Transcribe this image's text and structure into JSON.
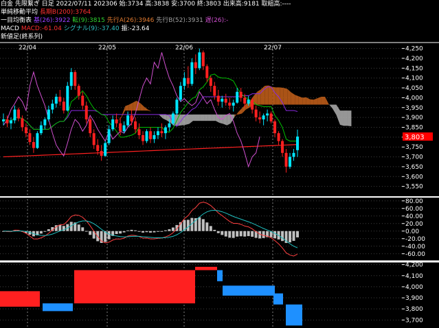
{
  "header": {
    "line1": "白金 先限繋ぎ 日足 2022/07/11 202306 始:3734 高:3838 安:3700 終:3803 出来高:9181 取組高:----",
    "line2_label": "単純移動平均",
    "line2_value": "長期B(200):3764",
    "line3_label": "一目均衡表",
    "line3_base": "基(26):3922",
    "line3_conv": "転(9):3815",
    "line3_spanA": "先行A(26):3946",
    "line3_spanB": "先行B(52):3931",
    "line3_lag": "遅(26):-",
    "line4_label": "MACD",
    "line4_macd": "MACD:-61.04",
    "line4_signal": "シグナル(9):-37.40",
    "line4_hist": "振:-23.64",
    "line5_label": "新値足(終系列)"
  },
  "colors": {
    "up": "#00e5ff",
    "down": "#ff2020",
    "ma200": "#ff2020",
    "base": "#8a2be2",
    "conversion": "#00c000",
    "lagging": "#d050d0",
    "cloud_bull": "#c8621a",
    "cloud_bear": "#b0b0b0",
    "macd": "#ff4040",
    "signal": "#20c0c0",
    "histogram": "#c0c0c0",
    "grid": "#404040",
    "price_tag": "#ff0000"
  },
  "chart_data": [
    {
      "type": "candlestick",
      "panel": "price",
      "x_labels": [
        "22/04",
        "22/05",
        "22/06",
        "22/07"
      ],
      "ylim": [
        3500,
        4280
      ],
      "y_ticks": [
        3550,
        3600,
        3650,
        3700,
        3750,
        3800,
        3850,
        3900,
        3950,
        4000,
        4050,
        4100,
        4150,
        4200,
        4250
      ],
      "y_tick_labels": [
        "3,550",
        "3,600",
        "3,650",
        "3,700",
        "3,750",
        "3,800",
        "3,850",
        "3,900",
        "3,950",
        "4,000",
        "4,050",
        "4,100",
        "4,150",
        "4,200",
        "4,250"
      ],
      "last_price_label": "3,803",
      "last_price": 3803,
      "candles": [
        [
          3880,
          3920,
          3860,
          3890
        ],
        [
          3890,
          3910,
          3850,
          3870
        ],
        [
          3870,
          3900,
          3840,
          3885
        ],
        [
          3885,
          3960,
          3870,
          3940
        ],
        [
          3940,
          3950,
          3880,
          3895
        ],
        [
          3895,
          3910,
          3830,
          3850
        ],
        [
          3850,
          3870,
          3800,
          3820
        ],
        [
          3820,
          3840,
          3760,
          3775
        ],
        [
          3775,
          3800,
          3720,
          3745
        ],
        [
          3745,
          3830,
          3740,
          3820
        ],
        [
          3820,
          3880,
          3810,
          3860
        ],
        [
          3860,
          3900,
          3840,
          3890
        ],
        [
          3890,
          3960,
          3880,
          3940
        ],
        [
          3940,
          3990,
          3920,
          3970
        ],
        [
          3970,
          4020,
          3950,
          4005
        ],
        [
          4005,
          4040,
          3960,
          3980
        ],
        [
          3980,
          4000,
          3920,
          3935
        ],
        [
          3935,
          4080,
          3930,
          4060
        ],
        [
          4060,
          4150,
          4040,
          4130
        ],
        [
          4130,
          4140,
          4040,
          4060
        ],
        [
          4060,
          4070,
          3990,
          4010
        ],
        [
          4010,
          4030,
          3940,
          3960
        ],
        [
          3960,
          3980,
          3870,
          3890
        ],
        [
          3890,
          3900,
          3800,
          3820
        ],
        [
          3820,
          3840,
          3740,
          3760
        ],
        [
          3760,
          3790,
          3710,
          3730
        ],
        [
          3730,
          3760,
          3680,
          3705
        ],
        [
          3705,
          3780,
          3700,
          3770
        ],
        [
          3770,
          3860,
          3760,
          3840
        ],
        [
          3840,
          3910,
          3830,
          3890
        ],
        [
          3890,
          3920,
          3850,
          3870
        ],
        [
          3870,
          3900,
          3810,
          3830
        ],
        [
          3830,
          3880,
          3820,
          3860
        ],
        [
          3860,
          3930,
          3850,
          3910
        ],
        [
          3910,
          3940,
          3860,
          3880
        ],
        [
          3880,
          3900,
          3820,
          3840
        ],
        [
          3840,
          3870,
          3790,
          3810
        ],
        [
          3810,
          3830,
          3760,
          3780
        ],
        [
          3780,
          3840,
          3770,
          3830
        ],
        [
          3830,
          3850,
          3770,
          3790
        ],
        [
          3790,
          3830,
          3770,
          3810
        ],
        [
          3810,
          3850,
          3790,
          3830
        ],
        [
          3830,
          3870,
          3800,
          3820
        ],
        [
          3820,
          3860,
          3790,
          3850
        ],
        [
          3850,
          3890,
          3830,
          3870
        ],
        [
          3870,
          3930,
          3860,
          3920
        ],
        [
          3920,
          4000,
          3910,
          3990
        ],
        [
          3990,
          4080,
          3980,
          4060
        ],
        [
          4060,
          4130,
          4040,
          4100
        ],
        [
          4100,
          4160,
          4050,
          4070
        ],
        [
          4070,
          4200,
          4060,
          4180
        ],
        [
          4180,
          4220,
          4120,
          4150
        ],
        [
          4150,
          4250,
          4140,
          4230
        ],
        [
          4230,
          4240,
          4140,
          4160
        ],
        [
          4160,
          4170,
          4080,
          4100
        ],
        [
          4100,
          4110,
          4030,
          4060
        ],
        [
          4060,
          4080,
          3990,
          4010
        ],
        [
          4010,
          4040,
          3960,
          3980
        ],
        [
          3980,
          4010,
          3950,
          3995
        ],
        [
          3995,
          4020,
          3960,
          3975
        ],
        [
          3975,
          4000,
          3940,
          3960
        ],
        [
          3960,
          3990,
          3930,
          3975
        ],
        [
          3975,
          4050,
          3970,
          4030
        ],
        [
          4030,
          4050,
          3980,
          4000
        ],
        [
          4000,
          4020,
          3950,
          3970
        ],
        [
          3970,
          4010,
          3960,
          3990
        ],
        [
          3990,
          4000,
          3920,
          3940
        ],
        [
          3940,
          3960,
          3880,
          3900
        ],
        [
          3900,
          3930,
          3870,
          3890
        ],
        [
          3890,
          3920,
          3860,
          3910
        ],
        [
          3910,
          3940,
          3880,
          3920
        ],
        [
          3920,
          3930,
          3870,
          3880
        ],
        [
          3880,
          3890,
          3800,
          3820
        ],
        [
          3820,
          3830,
          3760,
          3780
        ],
        [
          3780,
          3790,
          3700,
          3720
        ],
        [
          3720,
          3740,
          3620,
          3650
        ],
        [
          3650,
          3720,
          3640,
          3700
        ],
        [
          3700,
          3740,
          3680,
          3720
        ],
        [
          3734,
          3838,
          3700,
          3803
        ]
      ]
    },
    {
      "type": "line",
      "panel": "macd",
      "ylim": [
        -75,
        85
      ],
      "y_ticks": [
        -60,
        -40,
        -20,
        0,
        20,
        40,
        60,
        80
      ],
      "y_tick_labels": [
        "-60.00",
        "-40.00",
        "-20.00",
        "0.00",
        "20.00",
        "40.00",
        "60.00",
        "80.00"
      ],
      "macd_last": -61.04,
      "signal_last": -37.4,
      "histogram_last": -23.64
    },
    {
      "type": "bar",
      "panel": "new-price-bars",
      "ylim": [
        3640,
        4210
      ],
      "y_ticks": [
        3700,
        3800,
        3900,
        4000,
        4100,
        4200
      ],
      "y_tick_labels": [
        "3,700",
        "3,800",
        "3,900",
        "4,000",
        "4,100",
        "4,200"
      ],
      "blocks": [
        {
          "x0": 0,
          "x1": 58,
          "y0": 3820,
          "y1": 3960,
          "dir": "down"
        },
        {
          "x0": 62,
          "x1": 106,
          "y0": 3780,
          "y1": 3850,
          "dir": "up"
        },
        {
          "x0": 108,
          "x1": 284,
          "y0": 3850,
          "y1": 4150,
          "dir": "down"
        },
        {
          "x0": 284,
          "x1": 316,
          "y0": 4150,
          "y1": 4180,
          "dir": "down"
        },
        {
          "x0": 316,
          "x1": 324,
          "y0": 4050,
          "y1": 4150,
          "dir": "up"
        },
        {
          "x0": 324,
          "x1": 400,
          "y0": 3920,
          "y1": 4010,
          "dir": "up"
        },
        {
          "x0": 398,
          "x1": 412,
          "y0": 3840,
          "y1": 3940,
          "dir": "up"
        },
        {
          "x0": 416,
          "x1": 440,
          "y0": 3650,
          "y1": 3840,
          "dir": "up"
        }
      ]
    }
  ]
}
